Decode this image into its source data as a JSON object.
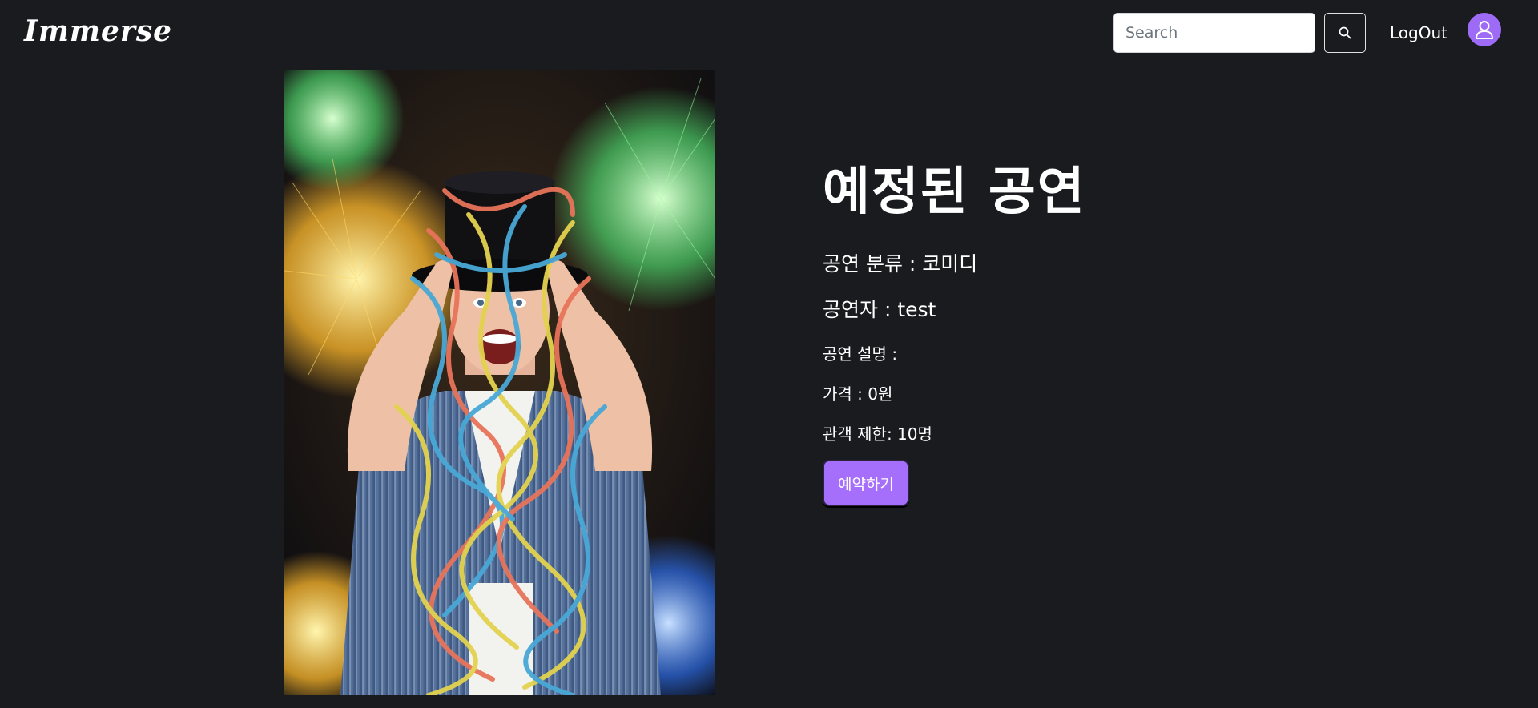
{
  "header": {
    "logo_text": "Immerse",
    "search_placeholder": "Search",
    "search_value": "",
    "search_icon": "search-icon",
    "logout_label": "LogOut",
    "avatar_icon": "user-icon",
    "avatar_color": "#9d6bf5"
  },
  "show": {
    "poster_subject": "performer-with-top-hat-and-streamers",
    "title": "예정된 공연",
    "category": "공연 분류 : 코미디",
    "performer": "공연자 : test",
    "description": "공연 설명 :",
    "price": "가격 : 0원",
    "capacity": "관객 제한: 10명",
    "reserve_label": "예약하기"
  },
  "colors": {
    "background": "#1a1b1f",
    "accent": "#a66ffb",
    "text": "#ffffff"
  }
}
